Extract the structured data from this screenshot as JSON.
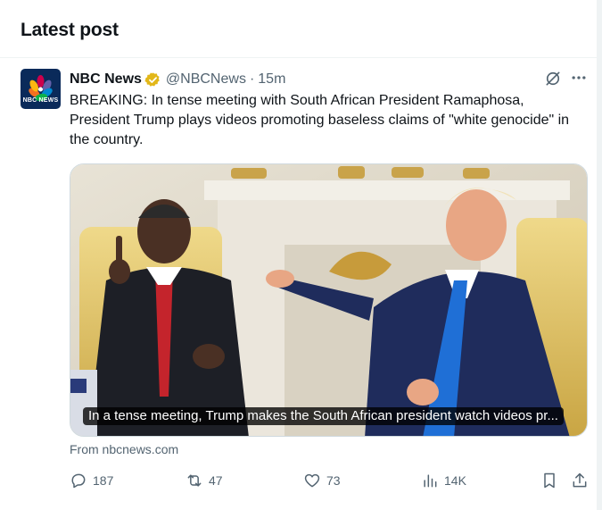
{
  "section": {
    "title": "Latest post"
  },
  "post": {
    "author_name": "NBC News",
    "avatar_text": "NBC NEWS",
    "handle": "@NBCNews",
    "separator": "·",
    "time": "15m",
    "text": "BREAKING: In tense meeting with South African President Ramaphosa, President Trump plays videos promoting baseless claims of \"white genocide\" in the country.",
    "card": {
      "caption": "In a tense meeting, Trump makes the South African president watch videos pr...",
      "source": "From nbcnews.com"
    },
    "metrics": {
      "replies": "187",
      "reposts": "47",
      "likes": "73",
      "views": "14K"
    }
  },
  "icons": {
    "verified": "verified-badge-icon",
    "grok": "grok-icon",
    "more": "more-icon",
    "reply": "reply-icon",
    "repost": "repost-icon",
    "like": "like-icon",
    "views": "views-icon",
    "bookmark": "bookmark-icon",
    "share": "share-icon"
  },
  "colors": {
    "text_primary": "#0f1419",
    "text_secondary": "#536471",
    "verified_gold": "#e2b719",
    "border": "#cfd9de"
  }
}
